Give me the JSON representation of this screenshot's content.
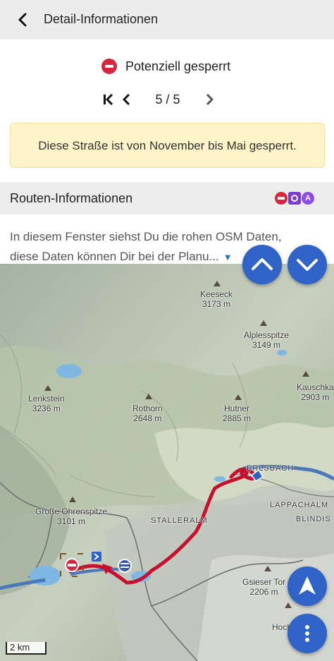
{
  "header": {
    "title": "Detail-Informationen"
  },
  "status": {
    "text": "Potenziell gesperrt",
    "icon": "no-entry-icon"
  },
  "pager": {
    "count": "5 / 5"
  },
  "notice": {
    "text": "Diese Straße ist von November bis Mai gesperrt."
  },
  "route_section": {
    "title": "Routen-Informationen",
    "icons": [
      "no-entry-icon",
      "camera-icon",
      "alpine-icon"
    ]
  },
  "description": {
    "line1": "In diesem Fenster siehst Du die rohen OSM Daten,",
    "line2": "diese Daten können Dir bei der Planu..."
  },
  "map": {
    "peaks": [
      {
        "name": "Keeseck",
        "elevation": "3173 m"
      },
      {
        "name": "Alplesspitze",
        "elevation": "3149 m"
      },
      {
        "name": "Lenkstein",
        "elevation": "3236 m"
      },
      {
        "name": "Rothorn",
        "elevation": "2648 m"
      },
      {
        "name": "Hutner",
        "elevation": "2885 m"
      },
      {
        "name": "Kauschka",
        "elevation": "2903 m"
      },
      {
        "name": "Große Ohrenspitze",
        "elevation": "3101 m"
      },
      {
        "name": "Gsieser Tor",
        "elevation": "2206 m"
      },
      {
        "name": "Hoch",
        "elevation": ""
      }
    ],
    "places": [
      "ERLSBACH",
      "LAPPACHALM",
      "BLINDIS",
      "STALLERALM"
    ],
    "scale": "2 km"
  },
  "colors": {
    "accent": "#2f63c7",
    "route": "#c8102e",
    "notice_bg": "#fdf3c8"
  }
}
